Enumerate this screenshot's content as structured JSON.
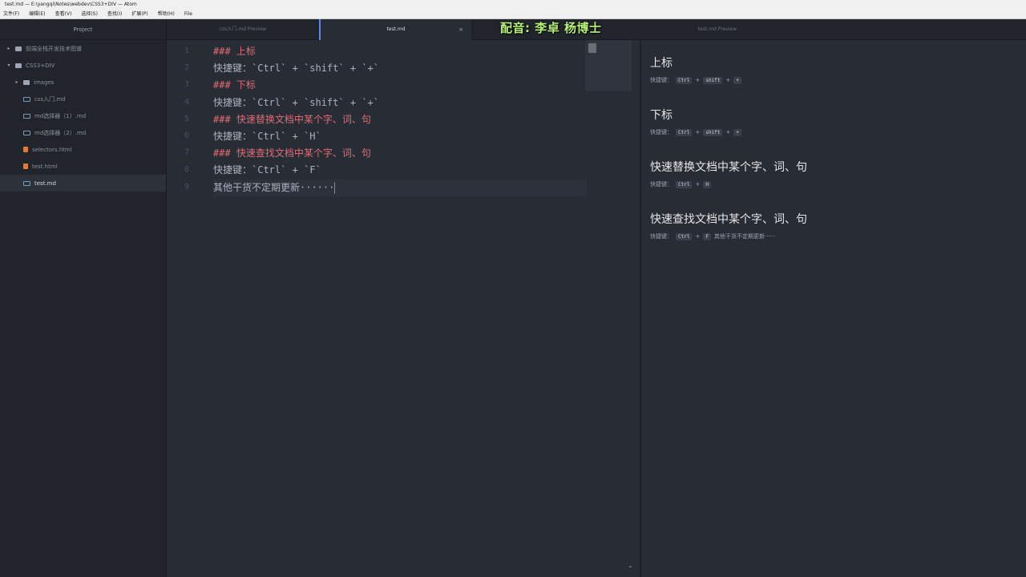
{
  "window": {
    "title": "test.md — E:\\yangqi\\Notes\\webdev\\CSS3+DIV — Atom"
  },
  "menu": [
    "文件(F)",
    "编辑(E)",
    "查看(V)",
    "选择(S)",
    "查找(I)",
    "扩展(P)",
    "帮助(H)",
    "File"
  ],
  "watermark": "配音: 李卓 杨博士",
  "tree": {
    "header": "Project",
    "items": [
      {
        "label": "前端全栈开发技术图谱",
        "type": "folder",
        "indent": 0,
        "expanded": false
      },
      {
        "label": "CSS3+DIV",
        "type": "folder",
        "indent": 0,
        "expanded": true
      },
      {
        "label": "images",
        "type": "folder",
        "indent": 1,
        "expanded": false
      },
      {
        "label": "css入门.md",
        "type": "md",
        "indent": 1
      },
      {
        "label": "md选择器（1）.md",
        "type": "md",
        "indent": 1
      },
      {
        "label": "md选择器（2）.md",
        "type": "md",
        "indent": 1
      },
      {
        "label": "selectors.html",
        "type": "html",
        "indent": 1
      },
      {
        "label": "test.html",
        "type": "html",
        "indent": 1
      },
      {
        "label": "test.md",
        "type": "md",
        "indent": 1,
        "selected": true
      }
    ]
  },
  "tabs": [
    {
      "label": "css入门.md Preview",
      "active": false
    },
    {
      "label": "test.md",
      "active": true
    },
    {
      "label": "test.md Preview",
      "active": false
    }
  ],
  "editor": {
    "lines": [
      {
        "num": "1",
        "text": "### 上标",
        "kind": "heading"
      },
      {
        "num": "2",
        "text": "快捷键：`Ctrl` + `shift` + `+`",
        "kind": "text"
      },
      {
        "num": "3",
        "text": "### 下标",
        "kind": "heading"
      },
      {
        "num": "4",
        "text": "快捷键：`Ctrl` + `shift` + `+`",
        "kind": "text"
      },
      {
        "num": "5",
        "text": "### 快速替换文档中某个字、词、句",
        "kind": "heading"
      },
      {
        "num": "6",
        "text": "快捷键：`Ctrl` + `H`",
        "kind": "text"
      },
      {
        "num": "7",
        "text": "### 快速查找文档中某个字、词、句",
        "kind": "heading"
      },
      {
        "num": "8",
        "text": "快捷键：`Ctrl` + `F`",
        "kind": "text"
      },
      {
        "num": "9",
        "text": "其他干货不定期更新······",
        "kind": "text",
        "cursor": true
      }
    ]
  },
  "preview": {
    "sections": [
      {
        "heading": "上标",
        "prefix": "快捷键：",
        "keys": [
          "Ctrl",
          "shift",
          "+"
        ],
        "suffix": ""
      },
      {
        "heading": "下标",
        "prefix": "快捷键：",
        "keys": [
          "Ctrl",
          "shift",
          "+"
        ],
        "suffix": ""
      },
      {
        "heading": "快速替换文档中某个字、词、句",
        "prefix": "快捷键：",
        "keys": [
          "Ctrl",
          "H"
        ],
        "suffix": ""
      },
      {
        "heading": "快速查找文档中某个字、词、句",
        "prefix": "快捷键：",
        "keys": [
          "Ctrl",
          "F"
        ],
        "suffix": "其他干货不定期更新······"
      }
    ]
  },
  "status": {
    "toggle_icon": "chevron-up-icon",
    "toggle_glyph": "⌃"
  }
}
